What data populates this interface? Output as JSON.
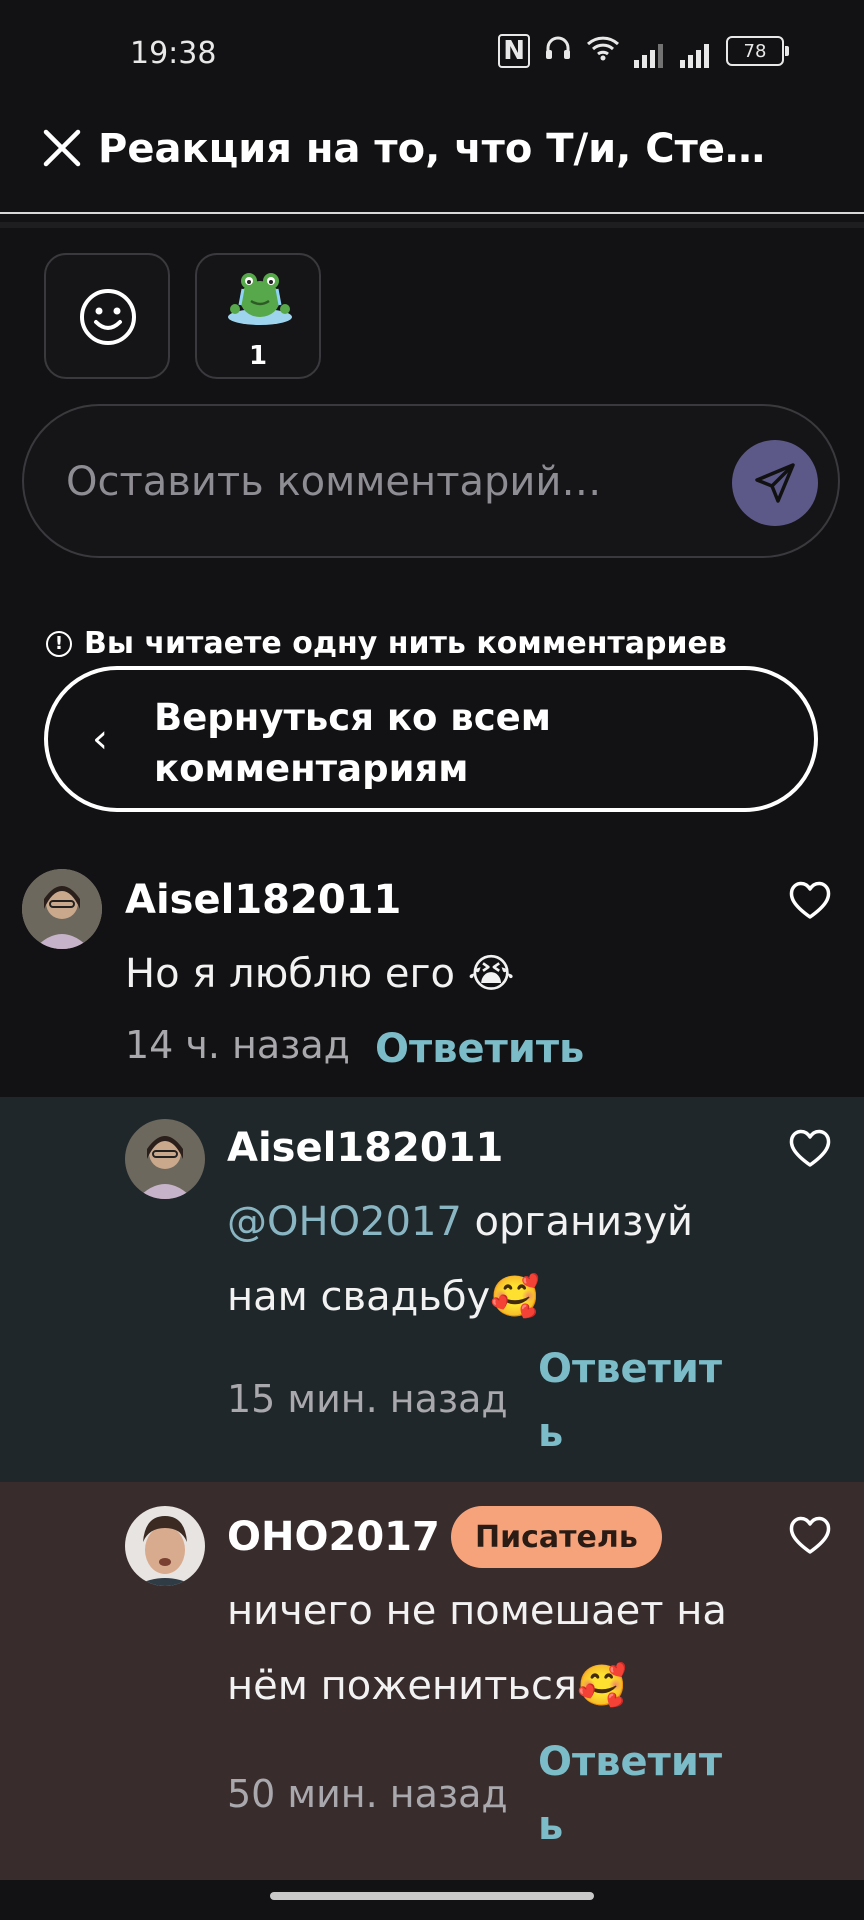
{
  "status_bar": {
    "time": "19:38",
    "battery": "78",
    "icons": [
      "nfc-icon",
      "headphones-icon",
      "wifi-icon",
      "signal-icon",
      "signal-icon",
      "battery-icon"
    ]
  },
  "header": {
    "title": "Реакция на то, что Т/и, Сте…",
    "close_icon": "close-icon"
  },
  "reactions": {
    "add_icon": "smiley-icon",
    "items": [
      {
        "icon": "frog-sticker-icon",
        "count": "1"
      }
    ]
  },
  "comment_input": {
    "placeholder": "Оставить комментарий…",
    "send_icon": "send-icon"
  },
  "thread_notice": {
    "text": "Вы читаете одну нить комментариев",
    "back_label": "Вернуться ко всем комментариям"
  },
  "comments": [
    {
      "username": "Aisel182011",
      "text": "Но я люблю его 😭",
      "time": "14 ч. назад",
      "reply_label": "Ответить"
    },
    {
      "username": "Aisel182011",
      "mention": "@OHO2017",
      "text": " организуй нам свадьбу🥰",
      "time": "15 мин. назад",
      "reply_label": "Ответить"
    },
    {
      "username": "OHO2017",
      "badge": "Писатель",
      "text": "ничего не помешает на нём пожениться🥰",
      "time": "50 мин. назад",
      "reply_label": "Ответить"
    }
  ],
  "colors": {
    "background": "#121113",
    "reply_accent": "#7bbcc8",
    "mention": "#8ab6c3",
    "badge": "#f6a37c",
    "send_button": "#5c5888"
  }
}
